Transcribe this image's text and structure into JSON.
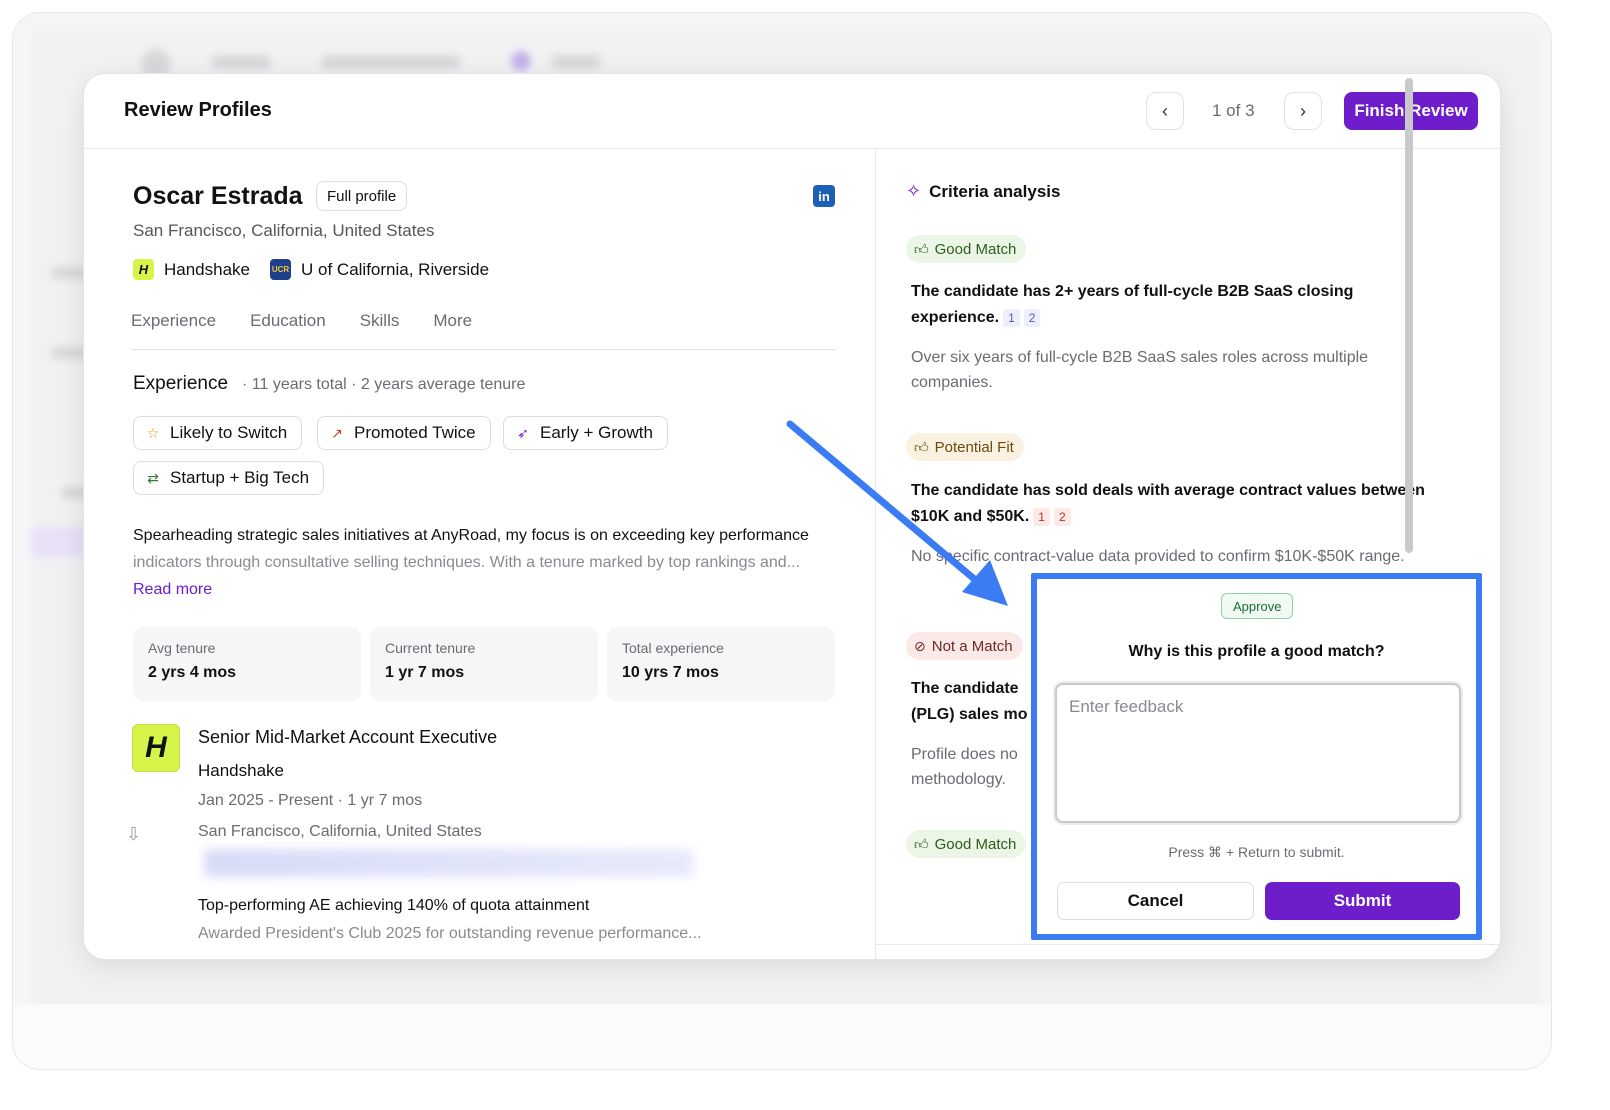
{
  "header": {
    "title": "Review Profiles",
    "pager": "1 of 3",
    "prev_icon": "chevron-left-icon",
    "next_icon": "chevron-right-icon",
    "finish_label": "Finish Review"
  },
  "profile": {
    "name": "Oscar Estrada",
    "full_profile_label": "Full profile",
    "location": "San Francisco, California, United States",
    "company": "Handshake",
    "school": "U of California, Riverside",
    "tabs": [
      "Experience",
      "Education",
      "Skills",
      "More"
    ],
    "experience_heading": "Experience",
    "experience_sub": "· 11 years total · 2 years average tenure",
    "chips": [
      {
        "label": "Likely to Switch",
        "icon": "star-icon"
      },
      {
        "label": "Promoted Twice",
        "icon": "trend-up-icon"
      },
      {
        "label": "Early + Growth",
        "icon": "rocket-icon"
      },
      {
        "label": "Startup + Big Tech",
        "icon": "transfer-icon"
      }
    ],
    "summary_line1": "Spearheading strategic sales initiatives at AnyRoad, my focus is on exceeding key performance",
    "summary_line2": "indicators through consultative selling techniques. With a tenure marked by top rankings and...",
    "read_more": "Read more",
    "stats": [
      {
        "label": "Avg tenure",
        "value": "2 yrs 4 mos"
      },
      {
        "label": "Current tenure",
        "value": "1 yr 7 mos"
      },
      {
        "label": "Total experience",
        "value": "10 yrs 7 mos"
      }
    ],
    "job": {
      "title": "Senior Mid-Market Account Executive",
      "company": "Handshake",
      "dates": "Jan 2025 - Present · 1 yr 7 mos",
      "location": "San Francisco, California, United States",
      "highlight": "Top-performing AE achieving 140% of quota attainment",
      "highlight_sub": "Awarded President's Club 2025 for outstanding revenue performance..."
    }
  },
  "criteria": {
    "title": "Criteria analysis",
    "items": [
      {
        "badge": "Good Match",
        "text": "The candidate has 2+ years of full-cycle B2B SaaS closing experience.",
        "refs": [
          "1",
          "2"
        ],
        "desc": "Over six years of full-cycle B2B SaaS sales roles across multiple companies."
      },
      {
        "badge": "Potential Fit",
        "text": "The candidate has sold deals with average contract values between $10K and $50K.",
        "refs": [
          "1",
          "2"
        ],
        "desc": "No specific contract-value data provided to confirm $10K-$50K range."
      },
      {
        "badge": "Not a Match",
        "text_line1": "The candidate",
        "text_line2": "(PLG) sales mo",
        "desc_line1": "Profile does no",
        "desc_line2": "methodology."
      },
      {
        "badge": "Good Match"
      }
    ]
  },
  "popover": {
    "tag": "Approve",
    "question": "Why is this profile a good match?",
    "placeholder": "Enter feedback",
    "hint": "Press ⌘ + Return to submit.",
    "cancel": "Cancel",
    "submit": "Submit"
  },
  "colors": {
    "accent": "#6d1dc9",
    "highlight_border": "#3b7cf5",
    "good": "#2c5d1c",
    "potential": "#6b4a10",
    "not_match": "#6d2a26"
  }
}
